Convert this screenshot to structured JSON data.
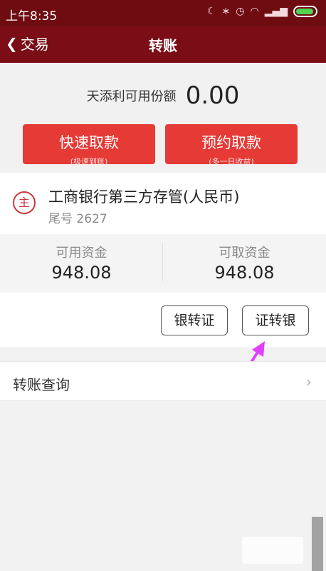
{
  "statusbar": {
    "time": "上午8:35",
    "icons": [
      "moon-icon",
      "bluetooth-icon",
      "alarm-icon",
      "wifi-icon",
      "signal-icon",
      "battery-icon"
    ]
  },
  "nav": {
    "back_label": "交易",
    "title": "转账"
  },
  "balance": {
    "label": "天添利可用份额",
    "value": "0.00"
  },
  "quick_withdraw": {
    "title": "快速取款",
    "subtitle": "(极速到账)"
  },
  "reserve_withdraw": {
    "title": "预约取款",
    "subtitle": "(多一日收益)"
  },
  "bank": {
    "badge": "主",
    "name": "工商银行第三方存管(人民币)",
    "tail": "尾号 2627"
  },
  "funds": {
    "available_label": "可用资金",
    "available_value": "948.08",
    "withdrawable_label": "可取资金",
    "withdrawable_value": "948.08"
  },
  "actions": {
    "bank_to_securities": "银转证",
    "securities_to_bank": "证转银"
  },
  "query": {
    "label": "转账查询",
    "chevron": "›"
  },
  "colors": {
    "header": "#7a0d15",
    "button_red": "#e53a35",
    "arrow": "#e040fb"
  }
}
